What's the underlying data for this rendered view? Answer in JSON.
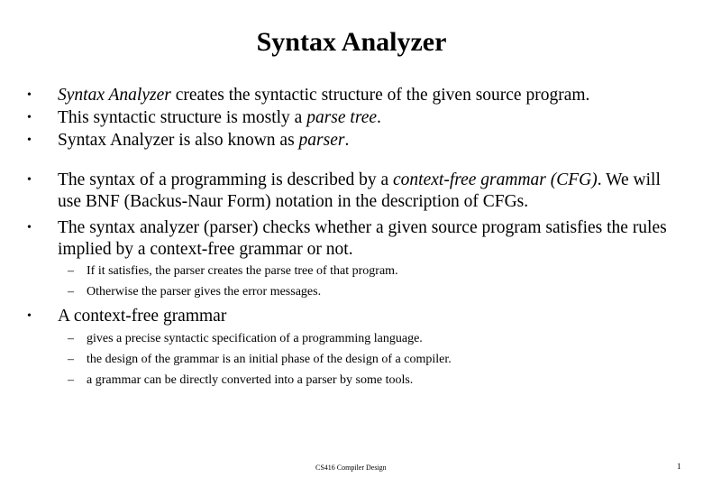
{
  "slide": {
    "title": "Syntax Analyzer",
    "bullets": [
      {
        "italic_prefix": "Syntax Analyzer",
        "text": " creates the syntactic structure of the given source program."
      },
      {
        "text": "This syntactic structure is mostly a ",
        "italic": "parse tree",
        "suffix": "."
      },
      {
        "text": "Syntax Analyzer is also known as ",
        "italic": "parser",
        "suffix": "."
      },
      {
        "text": "The syntax of a programming is described by a ",
        "italic": "context-free grammar (CFG)",
        "suffix": ". We will",
        "line2": "use BNF (Backus-Naur Form) notation in the description of CFGs."
      },
      {
        "text": "The syntax analyzer (parser) checks whether a given source program satisfies the rules",
        "line2": "implied by a context-free grammar or not.",
        "subitems": [
          "If it satisfies, the parser creates the parse tree of that program.",
          "Otherwise the parser gives the error messages."
        ]
      },
      {
        "text": "A context-free grammar",
        "subitems": [
          "gives a precise syntactic specification of a programming language.",
          "the design of the grammar is an initial phase of the design of a compiler.",
          "a grammar can be directly  converted into a parser by some tools."
        ]
      }
    ],
    "bullet_glyph": "•",
    "dash_glyph": "–",
    "footer": "CS416 Compiler Design",
    "page_number": "1"
  }
}
